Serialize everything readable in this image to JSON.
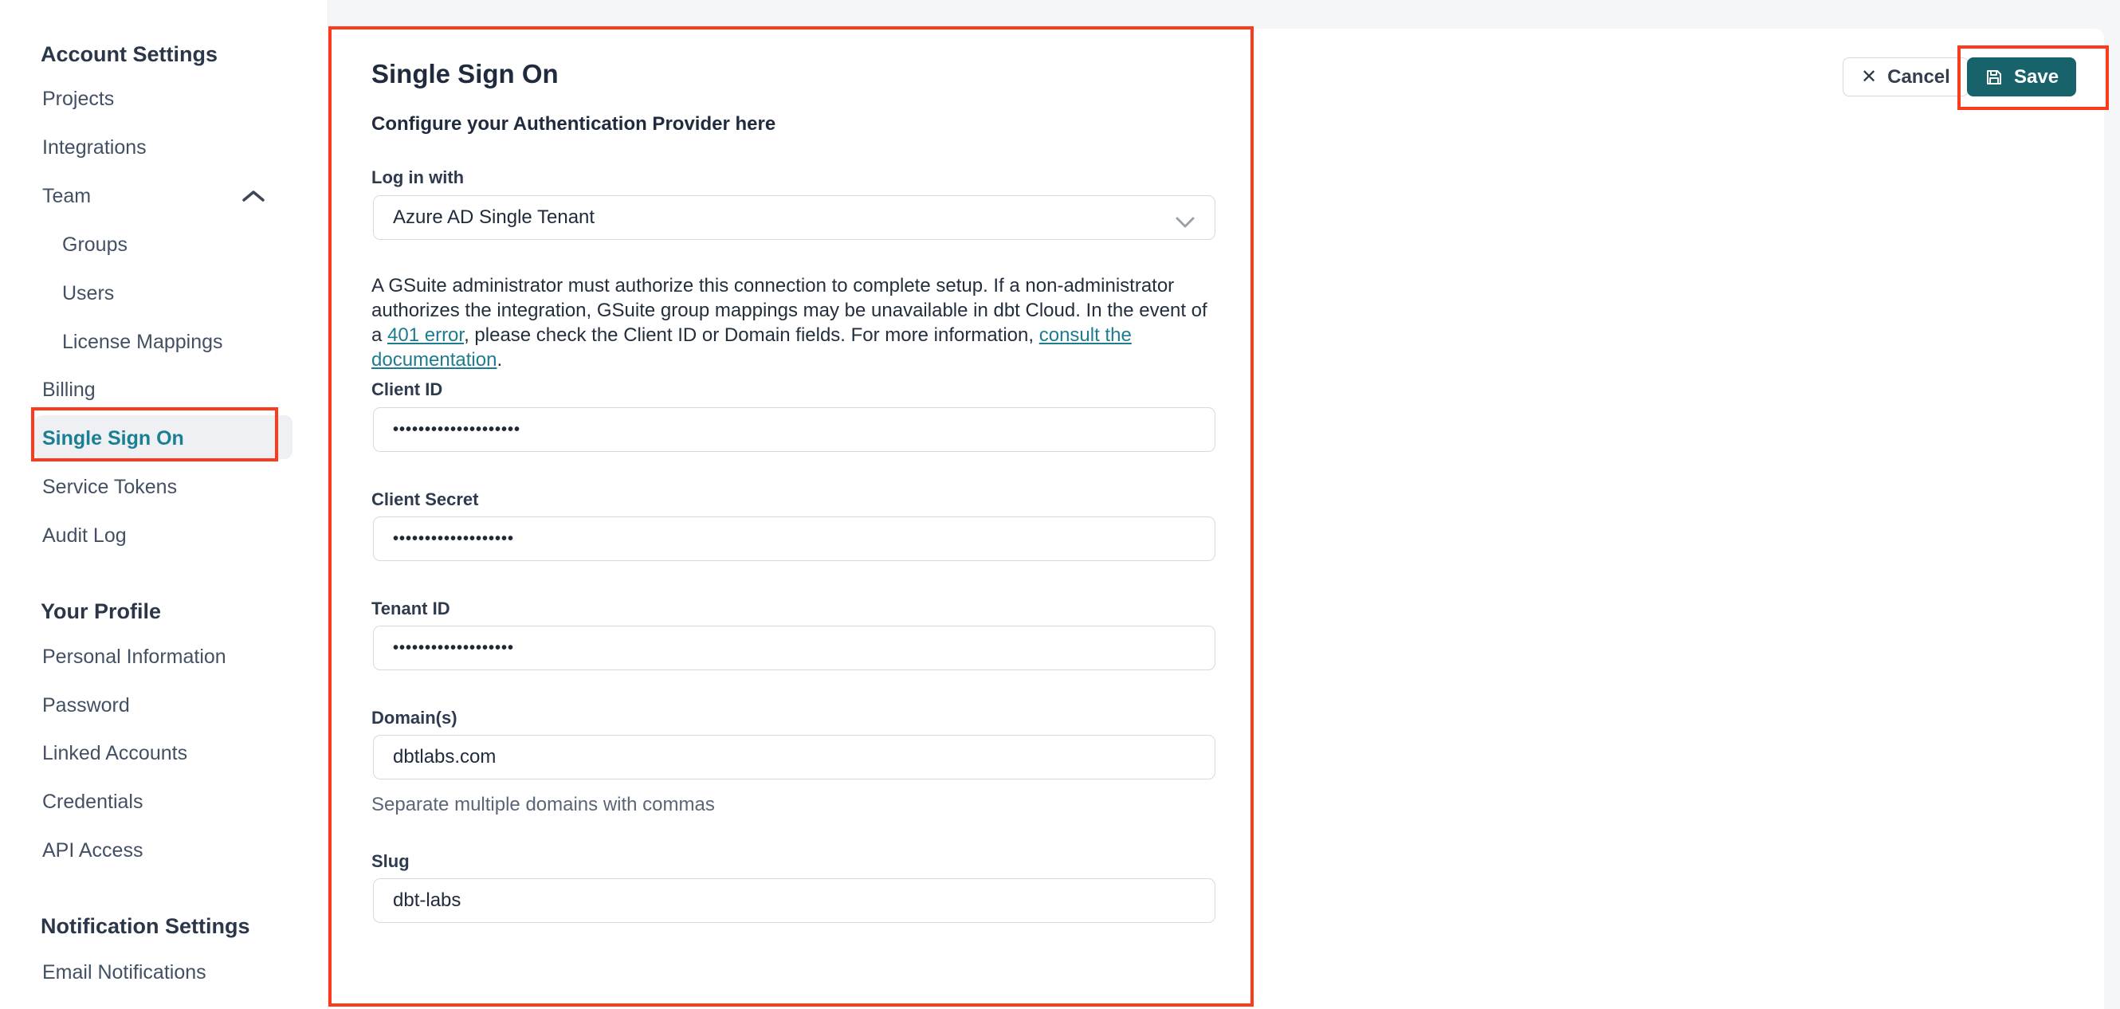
{
  "colors": {
    "save_button_teal": "#17626b",
    "active_item_teal": "#1b7f93",
    "link_teal": "#1d7c8f",
    "annotation_red": "#fb3a1e",
    "page_background": "#f5f6f8"
  },
  "sidebar": {
    "sections": [
      {
        "title": "Account Settings",
        "items": [
          {
            "label": "Projects"
          },
          {
            "label": "Integrations"
          },
          {
            "label": "Team"
          },
          {
            "label": "Groups"
          },
          {
            "label": "Users"
          },
          {
            "label": "License Mappings"
          },
          {
            "label": "Billing"
          },
          {
            "label": "Single Sign On"
          },
          {
            "label": "Service Tokens"
          },
          {
            "label": "Audit Log"
          }
        ]
      },
      {
        "title": "Your Profile",
        "items": [
          {
            "label": "Personal Information"
          },
          {
            "label": "Password"
          },
          {
            "label": "Linked Accounts"
          },
          {
            "label": "Credentials"
          },
          {
            "label": "API Access"
          }
        ]
      },
      {
        "title": "Notification Settings",
        "items": [
          {
            "label": "Email Notifications"
          }
        ]
      }
    ]
  },
  "main": {
    "title": "Single Sign On",
    "subtitle": "Configure your Authentication Provider here",
    "actions": {
      "cancel_label": "Cancel",
      "save_label": "Save"
    },
    "login_with": {
      "label": "Log in with",
      "value": "Azure AD Single Tenant"
    },
    "description": {
      "part1": "A GSuite administrator must authorize this connection to complete setup. If a non-administrator authorizes the integration, GSuite group mappings may be unavailable in dbt Cloud. In the event of a ",
      "link_401": "401 error",
      "part2": ", please check the Client ID or Domain fields. For more information, ",
      "link_docs": "consult the documentation",
      "part3": "."
    },
    "fields": {
      "client_id": {
        "label": "Client ID",
        "value": "••••••••••••••••••••"
      },
      "client_secret": {
        "label": "Client Secret",
        "value": "•••••••••••••••••••"
      },
      "tenant_id": {
        "label": "Tenant ID",
        "value": "•••••••••••••••••••"
      },
      "domains": {
        "label": "Domain(s)",
        "value": "dbtlabs.com",
        "helper": "Separate multiple domains with commas"
      },
      "slug": {
        "label": "Slug",
        "value": "dbt-labs"
      }
    }
  }
}
